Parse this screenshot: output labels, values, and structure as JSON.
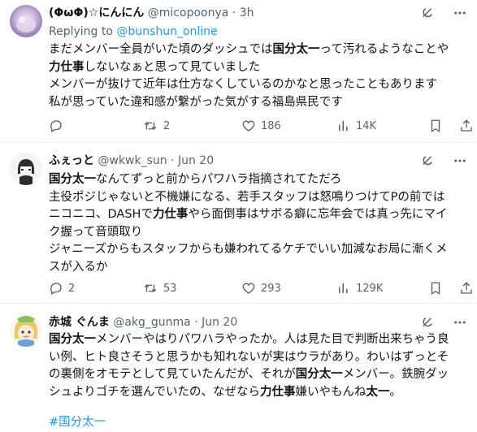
{
  "tweets": [
    {
      "name": "(ΦωΦ)☆にんにん",
      "handle": "@micopoonya · 3h",
      "reply_prefix": "Replying to ",
      "reply_to": "@bunshun_online",
      "lines": [
        [
          {
            "t": "まだメンバー全員がいた頃のダッシュでは"
          },
          {
            "t": "国分太一",
            "b": true
          },
          {
            "t": "って汚れるようなことや"
          }
        ],
        [
          {
            "t": "力仕事",
            "b": true
          },
          {
            "t": "しないなぁと思って見ていました"
          }
        ],
        [
          {
            "t": "メンバーが抜けて近年は仕方なくしているのかなと思ったこともあります"
          }
        ],
        [
          {
            "t": "私が思っていた違和感が繋がった気がする福島県民です"
          }
        ]
      ],
      "replies": "",
      "retweets": "2",
      "likes": "186",
      "views": "14K"
    },
    {
      "name": "ふぇっと",
      "handle": "@wkwk_sun · Jun 20",
      "lines": [
        [
          {
            "t": "国分太一",
            "b": true
          },
          {
            "t": "なんてずっと前からパワハラ指摘されてただろ"
          }
        ],
        [
          {
            "t": "主役ポジじゃないと不機嫌になる、若手スタッフは怒鳴りつけてPの前では"
          }
        ],
        [
          {
            "t": "ニコニコ、DASHで"
          },
          {
            "t": "力仕事",
            "b": true
          },
          {
            "t": "やら面倒事はサボる癖に忘年会では真っ先にマイ"
          }
        ],
        [
          {
            "t": "ク握って音頭取り"
          }
        ],
        [
          {
            "t": "ジャニーズからもスタッフからも嫌われてるケチでいい加減なお局に漸くメ"
          }
        ],
        [
          {
            "t": "スが入るか"
          }
        ]
      ],
      "replies": "2",
      "retweets": "53",
      "likes": "293",
      "views": "129K"
    },
    {
      "name": "赤城 ぐんま",
      "handle": "@akg_gunma · Jun 20",
      "lines": [
        [
          {
            "t": "国分太一",
            "b": true
          },
          {
            "t": "メンバーやはりパワハラやったか。人は見た目で判断出来ちゃう良"
          }
        ],
        [
          {
            "t": "い例、ヒト良さそうと思うかも知れないが実はウラがあり。わいはずっとそ"
          }
        ],
        [
          {
            "t": "の裏側をオモテとして見ていたんだが、それが"
          },
          {
            "t": "国分太一",
            "b": true
          },
          {
            "t": "メンバー。鉄腕ダッ"
          }
        ],
        [
          {
            "t": "シュよりゴチを選んでいたの、なぜなら"
          },
          {
            "t": "力仕事",
            "b": true
          },
          {
            "t": "嫌いやもんね"
          },
          {
            "t": "太一",
            "b": true
          },
          {
            "t": "。"
          }
        ]
      ],
      "hashtag": "#国分太一"
    }
  ],
  "icons": {
    "grok": "grok-icon",
    "more": "more-icon",
    "reply": "reply-icon",
    "retweet": "retweet-icon",
    "like": "like-icon",
    "views": "views-icon",
    "bookmark": "bookmark-icon",
    "share": "share-icon"
  },
  "colors": {
    "link": "#1d9bf0",
    "muted": "#536471",
    "text": "#0f1419",
    "divider": "#eff3f4"
  }
}
